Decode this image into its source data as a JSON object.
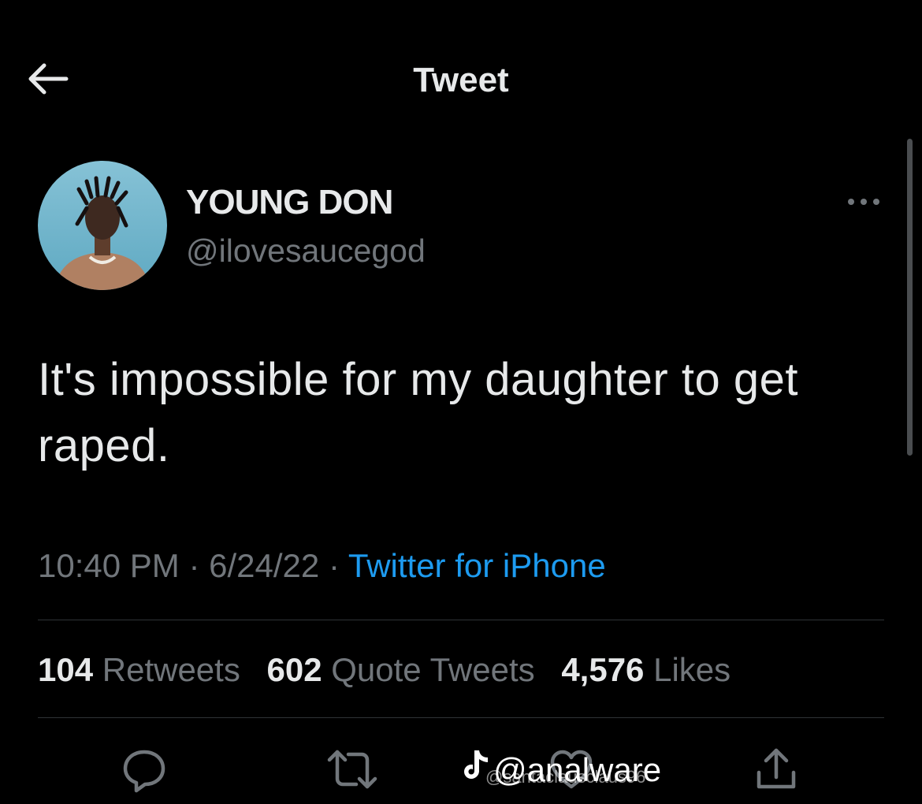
{
  "header": {
    "title": "Tweet",
    "back_icon": "arrow-left-icon"
  },
  "tweet": {
    "author": {
      "display_name": "YOUNG DON",
      "handle": "@ilovesaucegod",
      "avatar_icon": "avatar-photo"
    },
    "more_icon": "more-horizontal-icon",
    "text": "It's impossible for my daughter to get raped.",
    "meta": {
      "time": "10:40 PM",
      "separator": "·",
      "date": "6/24/22",
      "source": "Twitter for iPhone"
    },
    "stats": {
      "retweets_count": "104",
      "retweets_label": "Retweets",
      "quotes_count": "602",
      "quotes_label": "Quote Tweets",
      "likes_count": "4,576",
      "likes_label": "Likes"
    },
    "actions": [
      "reply-icon",
      "retweet-icon",
      "like-icon",
      "share-icon"
    ]
  },
  "watermark": {
    "icon": "tiktok-logo",
    "text": "@analware",
    "subtext": "@santaclausclaus96"
  },
  "colors": {
    "background": "#000000",
    "primary_text": "#e7e9ea",
    "secondary_text": "#71767b",
    "accent": "#1d9bf0",
    "divider": "#2f3336"
  }
}
